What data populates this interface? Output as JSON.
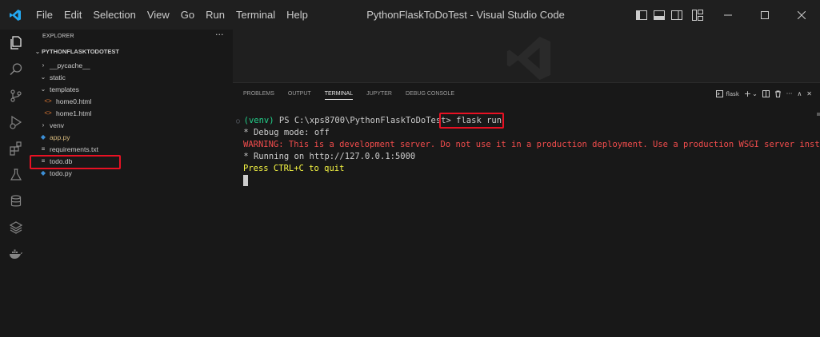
{
  "titlebar": {
    "menu": [
      "File",
      "Edit",
      "Selection",
      "View",
      "Go",
      "Run",
      "Terminal",
      "Help"
    ],
    "title": "PythonFlaskToDoTest - Visual Studio Code"
  },
  "sidebar": {
    "header": "EXPLORER",
    "more": "···",
    "root": "PYTHONFLASKTODOTEST",
    "items": [
      {
        "label": "__pycache__",
        "type": "folder",
        "expanded": false
      },
      {
        "label": "static",
        "type": "folder",
        "expanded": true
      },
      {
        "label": "templates",
        "type": "folder",
        "expanded": true
      },
      {
        "label": "home0.html",
        "type": "html"
      },
      {
        "label": "home1.html",
        "type": "html"
      },
      {
        "label": "venv",
        "type": "folder",
        "expanded": false
      },
      {
        "label": "app.py",
        "type": "py"
      },
      {
        "label": "requirements.txt",
        "type": "txt"
      },
      {
        "label": "todo.db",
        "type": "db"
      },
      {
        "label": "todo.py",
        "type": "py"
      }
    ]
  },
  "panel": {
    "tabs": [
      "PROBLEMS",
      "OUTPUT",
      "TERMINAL",
      "JUPYTER",
      "DEBUG CONSOLE"
    ],
    "active_tab": "TERMINAL",
    "terminal_name": "flask",
    "plus": "+",
    "chevron": "⌄",
    "more": "···",
    "chevron_up": "∧",
    "close": "✕"
  },
  "terminal": {
    "prompt_env": "(venv)",
    "prompt_path": " PS C:\\xps8700\\PythonFlaskToDoTest> ",
    "command": "flask run",
    "line_debug": " * Debug mode: off",
    "line_warning": "WARNING: This is a development server. Do not use it in a production deployment. Use a production WSGI server instead.",
    "line_running": " * Running on http://127.0.0.1:5000",
    "line_quit": "Press CTRL+C to quit"
  },
  "colors": {
    "accent": "#007acc",
    "annotation": "#e81123"
  }
}
